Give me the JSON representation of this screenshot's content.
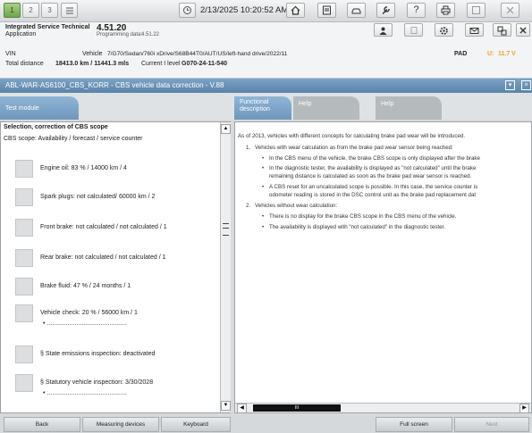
{
  "toolbar": {
    "btn1": "1",
    "btn2": "2",
    "btn3": "3",
    "datetime": "2/13/2025 10:20:52 AM",
    "icons": [
      "list-icon",
      "clock-icon",
      "home-icon",
      "document-icon",
      "car-icon",
      "wrench-icon",
      "help-icon",
      "print-icon",
      "window-icon",
      "close-icon"
    ]
  },
  "info": {
    "app_name": "Integrated Service Technical",
    "app_label": "Application",
    "version": "4.51.20",
    "prog_label": "Programming data:",
    "prog_value": "4.51.22",
    "vin_label": "VIN",
    "vehicle_label": "Vehicle",
    "vehicle_value": "7/G70/Sedan/760i xDrive/S68B44T0/AUT/US/left-hand drive/2022/11",
    "distance_label": "Total distance",
    "distance_value": "18413.0 km / 11441.3 mls",
    "ilevel_label": "Current I level",
    "ilevel_value": "G070-24-11-540",
    "pad_label": "PAD",
    "voltage_prefix": "U:",
    "voltage_value": "11.7 V",
    "voltage_color": "#f0a020"
  },
  "titlebar": {
    "title": "ABL-WAR-AS6100_CBS_KORR - CBS vehicle data correction - V.88"
  },
  "tabs": {
    "test_module": "Test module",
    "functional_line1": "Functional",
    "functional_line2": "description",
    "help1": "Help",
    "help2": "Help"
  },
  "left": {
    "heading": "Selection, correction of CBS scope",
    "subheading": "CBS scope: Availability / forecast / service counter",
    "rows": [
      "Engine oil: 83 % / 14000 km / 4",
      "Spark plugs: not calculated/ 60000 km / 2",
      "Front brake: not calculated / not calculated / 1",
      "Rear brake: not calculated / not calculated / 1",
      "Brake fluid: 47 % / 24 months / 1",
      "Vehicle check: 20 % / 56000 km  / 1",
      "§ State emissions inspection: deactivated",
      "§ Statutory vehicle inspection: 3/30/2028"
    ],
    "bullet_line": "• ..............................................",
    "scroll_up": "▲",
    "scroll_down": "▼"
  },
  "right": {
    "intro": "As of 2013, vehicles with different concepts for calculating brake pad wear will be introduced.",
    "item1_num": "1.",
    "item1": "Vehicles with wear calculation as from the brake pad wear sensor being reached:",
    "item1_b1": "In the CBS menu of the vehicle, the brake CBS scope is only displayed after the brake",
    "item1_b2a": "In the diagnostic tester, the availability is displayed as \"not calculated\" until the brake",
    "item1_b2b": "remaining distance is calculated as soon as the brake pad wear sensor is reached.",
    "item1_b3a": "A CBS reset for an uncalculated scope is possible. In this case, the service counter is",
    "item1_b3b": "odometer reading is stored in the DSC control unit as the brake pad replacement dat",
    "item2_num": "2.",
    "item2": "Vehicles without wear calculation:",
    "item2_b1": "There is no display for the brake CBS scope in the CBS menu of the vehicle.",
    "item2_b2": "The availability is displayed with \"not calculated\" in the diagnostic tester.",
    "scroll_left": "◀",
    "scroll_right": "▶",
    "thumb_grip": "III"
  },
  "bottom": {
    "back": "Back",
    "measuring": "Measuring devices",
    "keyboard": "Keyboard",
    "fullscreen": "Full screen",
    "next": "Next"
  }
}
